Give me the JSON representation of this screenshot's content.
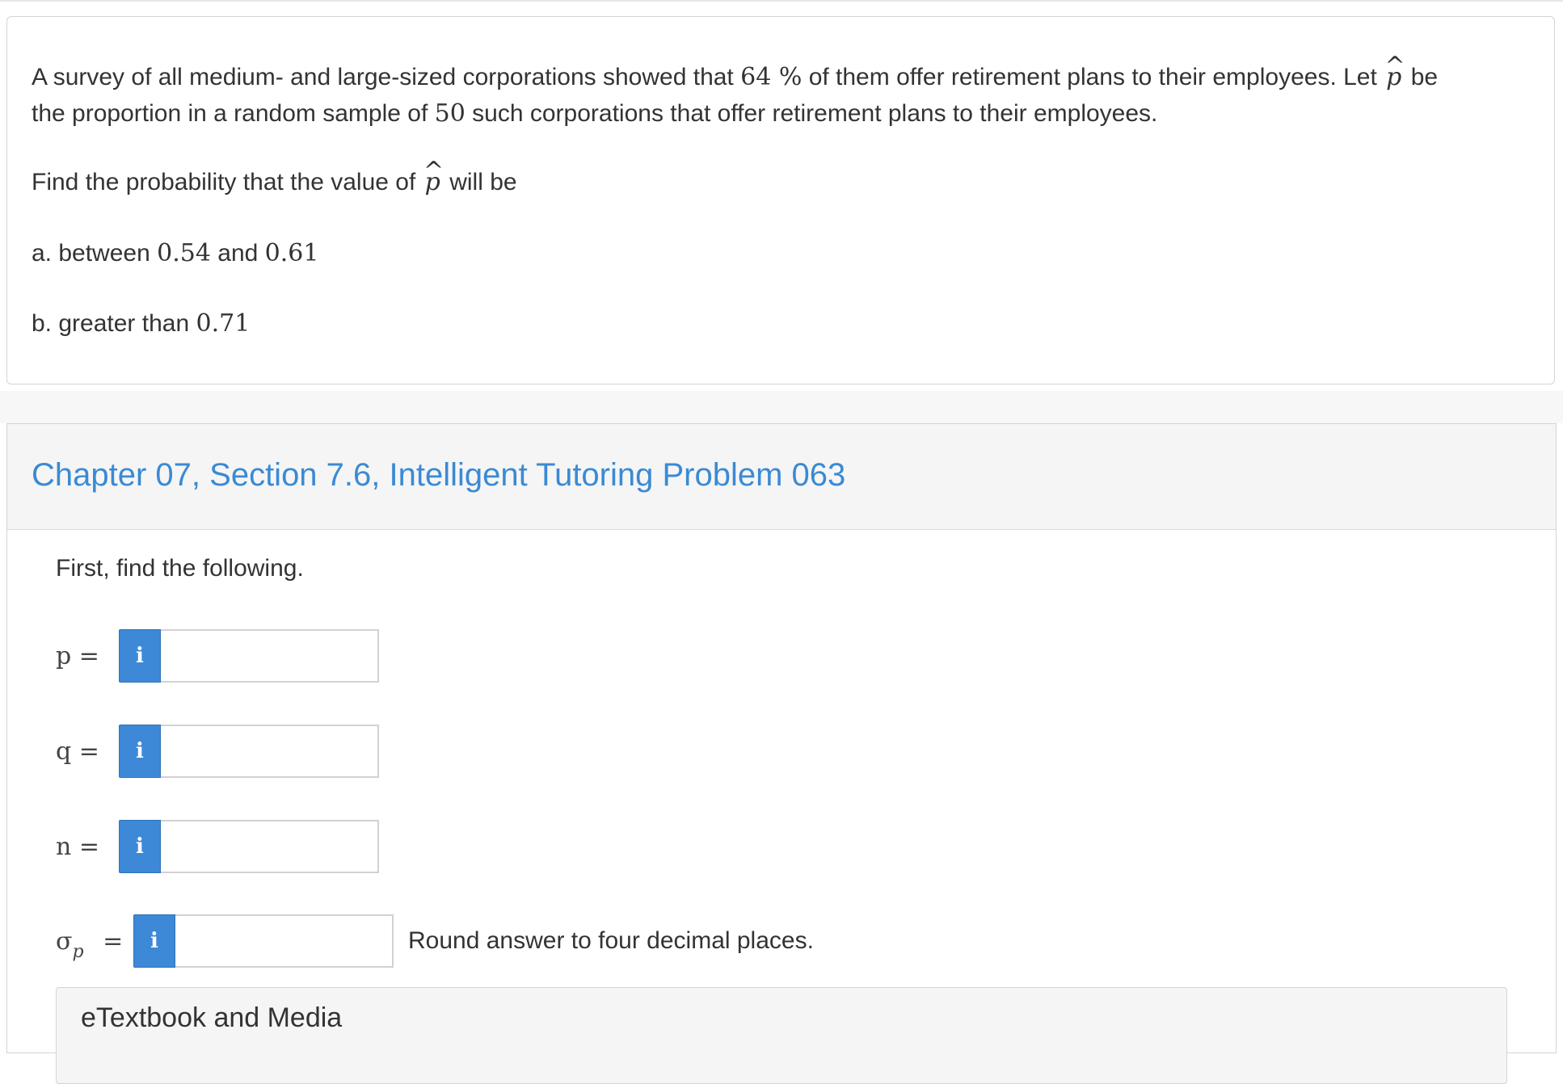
{
  "problem": {
    "intro_part1": "A survey of all medium- and large-sized corporations showed that",
    "percent_value": "64 %",
    "intro_part2": "of them offer retirement plans to their employees. Let",
    "phat_symbol": "p",
    "intro_part3": "be",
    "intro_line2_part1": "the proportion in a random sample of",
    "sample_size": "50",
    "intro_line2_part2": "such corporations that offer retirement plans to their employees.",
    "question_part1": "Find the probability that the value of",
    "question_part2": "will be",
    "part_a_prefix": "a. between",
    "part_a_low": "0.54",
    "part_a_and": "and",
    "part_a_high": "0.61",
    "part_b_prefix": "b. greater than",
    "part_b_value": "0.71"
  },
  "tutor": {
    "title": "Chapter 07, Section 7.6, Intelligent Tutoring Problem 063",
    "instruction": "First, find the following.",
    "info_glyph": "i",
    "rows": [
      {
        "label": "p =",
        "value": ""
      },
      {
        "label": "q =",
        "value": ""
      },
      {
        "label": "n =",
        "value": ""
      },
      {
        "label_sigma": "σ",
        "label_sub": "p",
        "label_eq": "=",
        "value": "",
        "hint": "Round answer to four decimal places."
      }
    ],
    "media_label": "eTextbook and Media"
  },
  "colors": {
    "title_blue": "#3a8ad4",
    "info_button": "#3d89d8",
    "card_border": "#d4d4d4"
  }
}
